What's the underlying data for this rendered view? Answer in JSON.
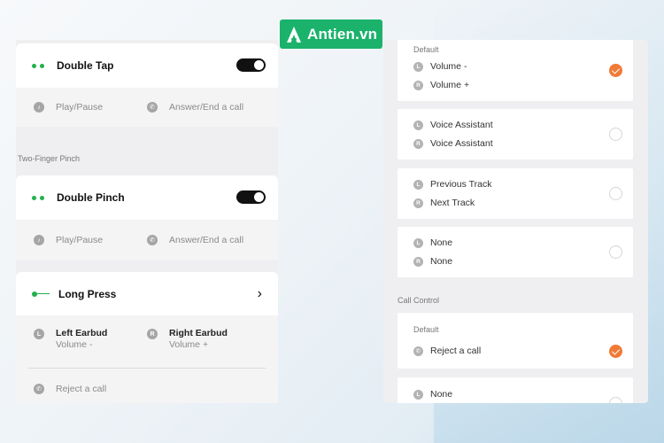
{
  "brand": {
    "logo_text": "Antien.vn",
    "color": "#1bb26c"
  },
  "accent_green": "#22b04b",
  "accent_orange": "#f07a36",
  "left_panel": {
    "double_tap": {
      "title": "Double Tap",
      "toggle_on": true,
      "action_left": {
        "icon": "music-note-icon",
        "label": "Play/Pause"
      },
      "action_right": {
        "icon": "phone-icon",
        "label": "Answer/End a call"
      }
    },
    "section_two_finger": "Two-Finger Pinch",
    "double_pinch": {
      "title": "Double Pinch",
      "toggle_on": true,
      "action_left": {
        "icon": "music-note-icon",
        "label": "Play/Pause"
      },
      "action_right": {
        "icon": "phone-icon",
        "label": "Answer/End a call"
      }
    },
    "long_press": {
      "title": "Long Press",
      "left": {
        "badge": "L",
        "title": "Left Earbud",
        "value": "Volume -"
      },
      "right": {
        "badge": "R",
        "title": "Right Earbud",
        "value": "Volume +"
      },
      "call_action": {
        "icon": "phone-icon",
        "label": "Reject a call"
      }
    }
  },
  "right_panel": {
    "options": [
      {
        "caption": "Default",
        "left_badge": "L",
        "left": "Volume -",
        "right_badge": "R",
        "right": "Volume +",
        "selected": true
      },
      {
        "left_badge": "L",
        "left": "Voice Assistant",
        "right_badge": "R",
        "right": "Voice Assistant",
        "selected": false
      },
      {
        "left_badge": "L",
        "left": "Previous Track",
        "right_badge": "R",
        "right": "Next Track",
        "selected": false
      },
      {
        "left_badge": "L",
        "left": "None",
        "right_badge": "R",
        "right": "None",
        "selected": false
      }
    ],
    "section_call_control": "Call Control",
    "call_options": [
      {
        "caption": "Default",
        "icon": "phone-icon",
        "label": "Reject a call",
        "selected": true
      },
      {
        "badge": "L",
        "label": "None",
        "selected": false
      }
    ]
  }
}
